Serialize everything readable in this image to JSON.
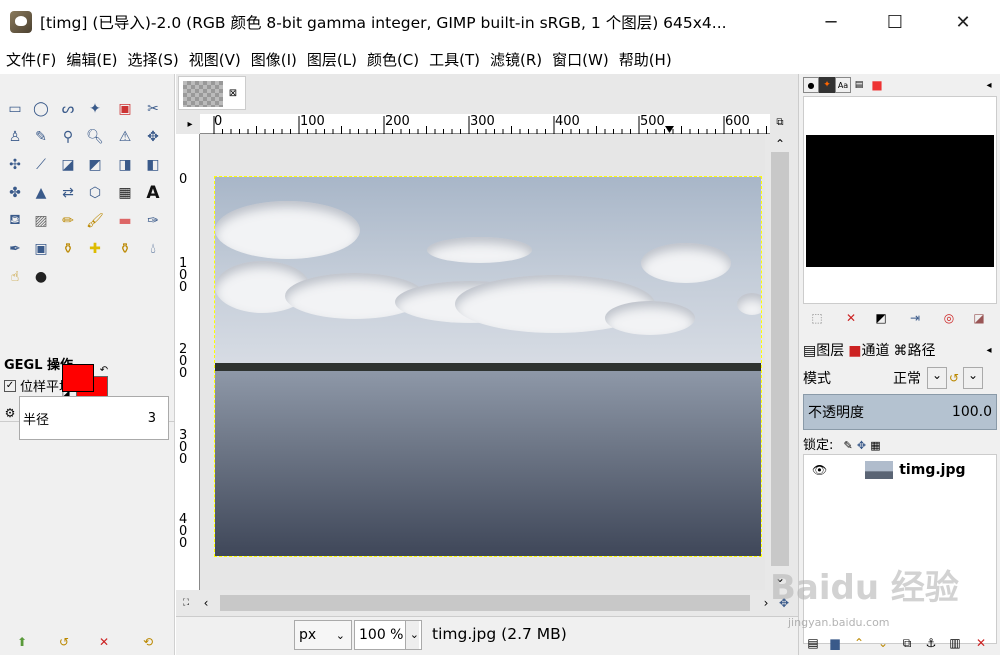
{
  "window": {
    "title": "[timg] (已导入)-2.0 (RGB 颜色 8-bit gamma integer, GIMP built-in sRGB, 1 个图层) 645x4...",
    "minimize": "─",
    "maximize": "☐",
    "close": "✕"
  },
  "menu": [
    "文件(F)",
    "编辑(E)",
    "选择(S)",
    "视图(V)",
    "图像(I)",
    "图层(L)",
    "颜色(C)",
    "工具(T)",
    "滤镜(R)",
    "窗口(W)",
    "帮助(H)"
  ],
  "toolbox": {
    "tool_options_title": "GEGL 操作",
    "checkbox_label": "位样平均",
    "radius_label": "半径",
    "radius_value": "3"
  },
  "canvas": {
    "ruler_h": [
      "0",
      "100",
      "200",
      "300",
      "400",
      "500",
      "600"
    ],
    "ruler_v": [
      "0",
      "1\n0\n0",
      "2\n0\n0",
      "3\n0\n0",
      "4\n0\n0"
    ]
  },
  "statusbar": {
    "unit": "px",
    "zoom": "100 %",
    "file_info": "timg.jpg (2.7 MB)"
  },
  "layers": {
    "tabs": [
      "图层",
      "通道",
      "路径"
    ],
    "mode_label": "模式",
    "mode_value": "正常",
    "opacity_label": "不透明度",
    "opacity_value": "100.0",
    "lock_label": "锁定:",
    "layer_name": "timg.jpg"
  },
  "watermark": {
    "main": "Baidu 经验",
    "sub": "jingyan.baidu.com"
  }
}
